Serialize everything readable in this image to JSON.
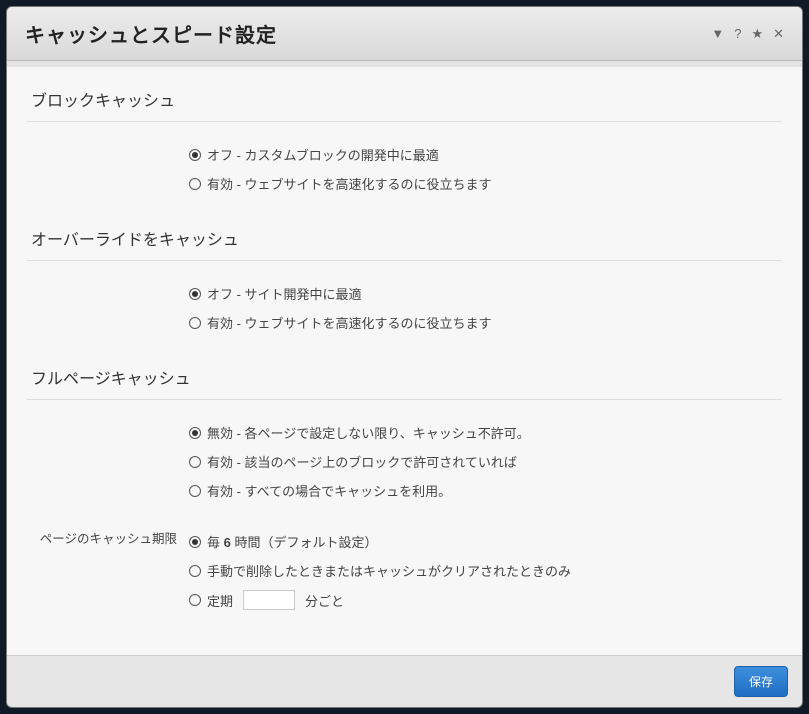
{
  "header": {
    "title": "キャッシュとスピード設定"
  },
  "sections": {
    "block_cache": {
      "title": "ブロックキャッシュ",
      "options": {
        "off": "オフ - カスタムブロックの開発中に最適",
        "on": "有効 - ウェブサイトを高速化するのに役立ちます"
      }
    },
    "override_cache": {
      "title": "オーバーライドをキャッシュ",
      "options": {
        "off": "オフ - サイト開発中に最適",
        "on": "有効 - ウェブサイトを高速化するのに役立ちます"
      }
    },
    "fullpage_cache": {
      "title": "フルページキャッシュ",
      "options": {
        "disabled": "無効 - 各ページで設定しない限り、キャッシュ不許可。",
        "blocks": "有効 - 該当のページ上のブロックで許可されていれば",
        "all": "有効 - すべての場合でキャッシュを利用。"
      }
    },
    "cache_lifetime": {
      "label": "ページのキャッシュ期限",
      "options": {
        "default_prefix": "毎 ",
        "default_value": "6",
        "default_suffix": " 時間（デフォルト設定）",
        "manual": "手動で削除したときまたはキャッシュがクリアされたときのみ",
        "periodic_prefix": "定期",
        "periodic_suffix": "分ごと"
      }
    }
  },
  "footer": {
    "save": "保存"
  }
}
